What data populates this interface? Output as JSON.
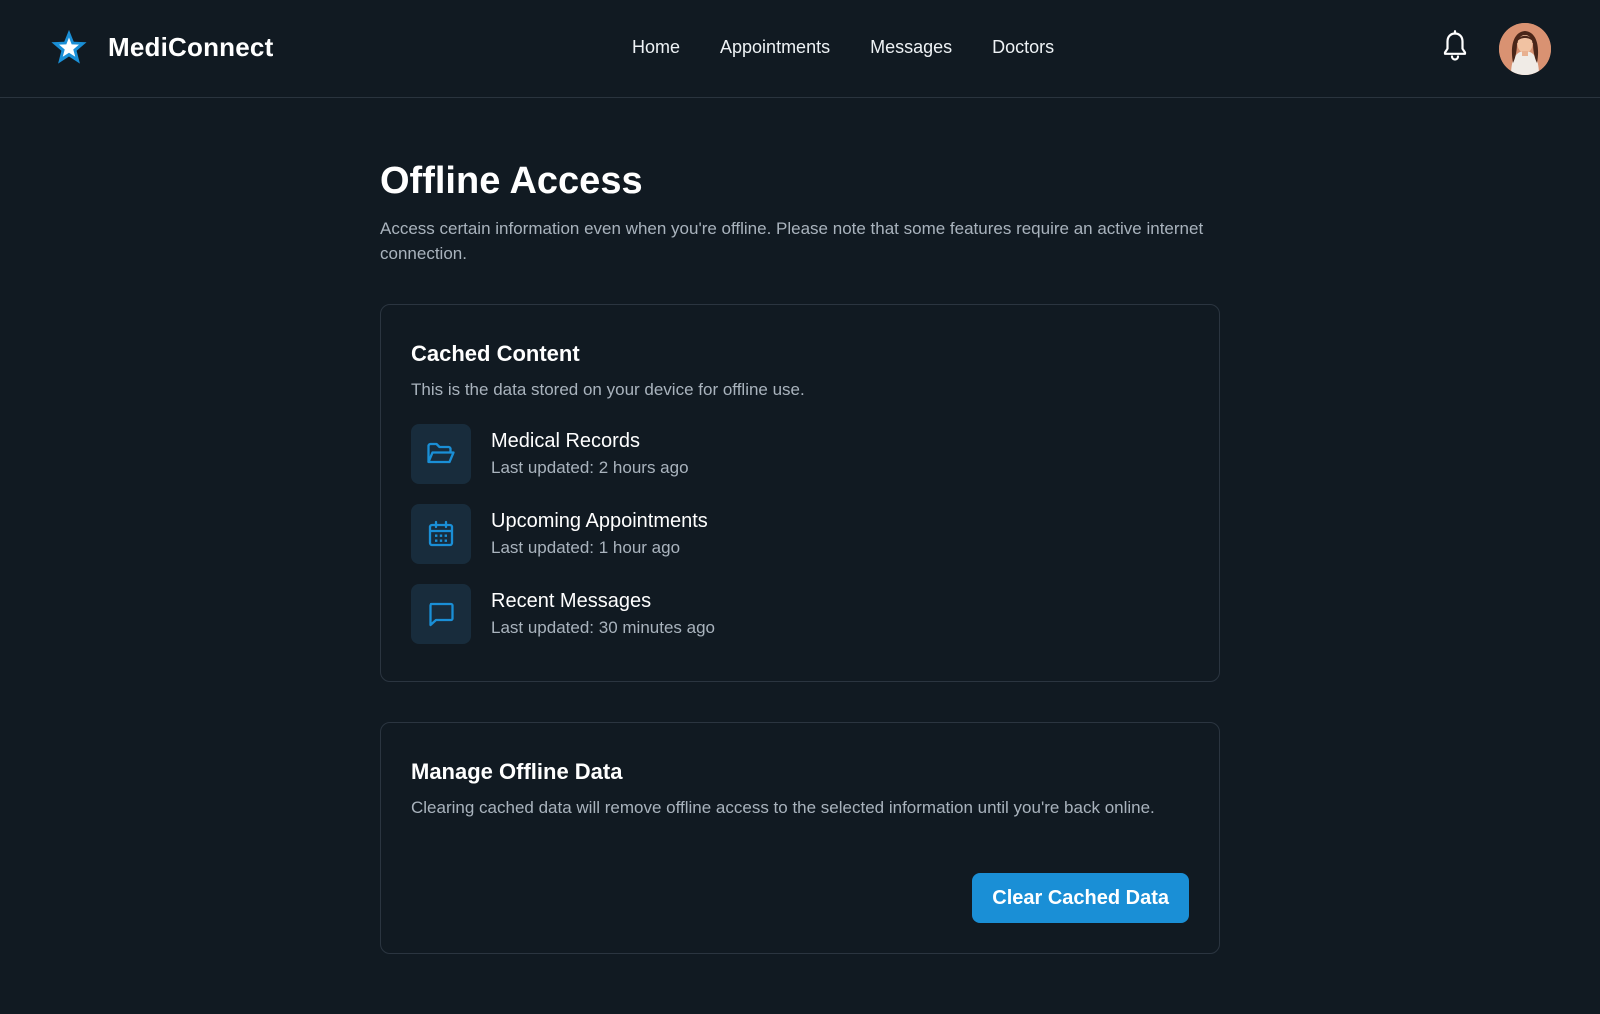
{
  "header": {
    "brand_name": "MediConnect",
    "brand_icon": "star-icon",
    "nav": [
      {
        "label": "Home"
      },
      {
        "label": "Appointments"
      },
      {
        "label": "Messages"
      },
      {
        "label": "Doctors"
      }
    ],
    "notification_icon": "bell-icon",
    "avatar_icon": "user-avatar"
  },
  "page": {
    "title": "Offline Access",
    "description": "Access certain information even when you're offline. Please note that some features require an active internet connection."
  },
  "cached_content": {
    "title": "Cached Content",
    "description": "This is the data stored on your device for offline use.",
    "items": [
      {
        "icon": "folder-open-icon",
        "title": "Medical Records",
        "updated": "Last updated: 2 hours ago"
      },
      {
        "icon": "calendar-icon",
        "title": "Upcoming Appointments",
        "updated": "Last updated: 1 hour ago"
      },
      {
        "icon": "message-icon",
        "title": "Recent Messages",
        "updated": "Last updated: 30 minutes ago"
      }
    ]
  },
  "manage": {
    "title": "Manage Offline Data",
    "description": "Clearing cached data will remove offline access to the selected information until you're back online.",
    "button_label": "Clear Cached Data"
  },
  "colors": {
    "background": "#111a22",
    "accent": "#1a8fd6",
    "icon_tile": "#182c3c",
    "muted_text": "#a9b3bd"
  }
}
